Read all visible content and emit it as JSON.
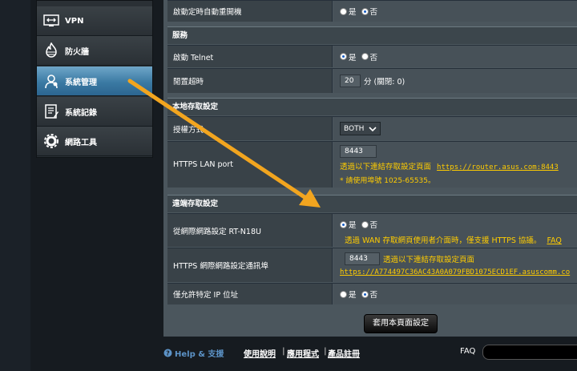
{
  "sidebar": {
    "items": [
      {
        "label": "VPN",
        "icon": "vpn-icon"
      },
      {
        "label": "防火牆",
        "icon": "firewall-icon"
      },
      {
        "label": "系統管理",
        "icon": "admin-icon",
        "active": true
      },
      {
        "label": "系統記錄",
        "icon": "log-icon"
      },
      {
        "label": "網路工具",
        "icon": "tools-icon"
      }
    ]
  },
  "top_row": {
    "label": "啟動定時自動重開機",
    "yes": "是",
    "no": "否",
    "selected": "no"
  },
  "service": {
    "title": "服務",
    "telnet_label": "啟動 Telnet",
    "telnet_yes": "是",
    "telnet_no": "否",
    "telnet_selected": "yes",
    "idle_label": "閒置超時",
    "idle_value": "20",
    "idle_unit": "分 (關閉: 0)"
  },
  "local_access": {
    "title": "本地存取設定",
    "auth_label": "授權方式",
    "auth_value": "BOTH",
    "https_port_label": "HTTPS LAN port",
    "https_port_value": "8443",
    "https_hint": "透過以下連結存取設定頁面",
    "https_link": "https://router.asus.com:8443",
    "port_note": "* 請使用埠號 1025-65535。"
  },
  "remote_access": {
    "title": "遠端存取設定",
    "wan_label": "從網際網路設定 RT-N18U",
    "wan_yes": "是",
    "wan_no": "否",
    "wan_selected": "yes",
    "wan_note": "透過 WAN 存取網頁使用者介面時，僅支援 HTTPS 協議。",
    "wan_faq": "FAQ",
    "https_port_label": "HTTPS 網際網路設定通訊埠",
    "https_port_value": "8443",
    "https_hint": "透過以下連結存取設定頁面",
    "https_link": "https://A774497C36AC43A0A079FBD1075ECD1EF.asuscomm.co",
    "ip_label": "僅允許特定 IP 位址",
    "ip_yes": "是",
    "ip_no": "否",
    "ip_selected": "no"
  },
  "apply_button": "套用本頁面設定",
  "footer": {
    "help": "Help & 支援",
    "manual": "使用說明",
    "utility": "應用程式",
    "registration": "產品註冊",
    "faq": "FAQ"
  },
  "colors": {
    "accent_link": "#ffcc00",
    "active_tab": "#3b7aa3",
    "annotation_arrow": "#f2a51f"
  }
}
